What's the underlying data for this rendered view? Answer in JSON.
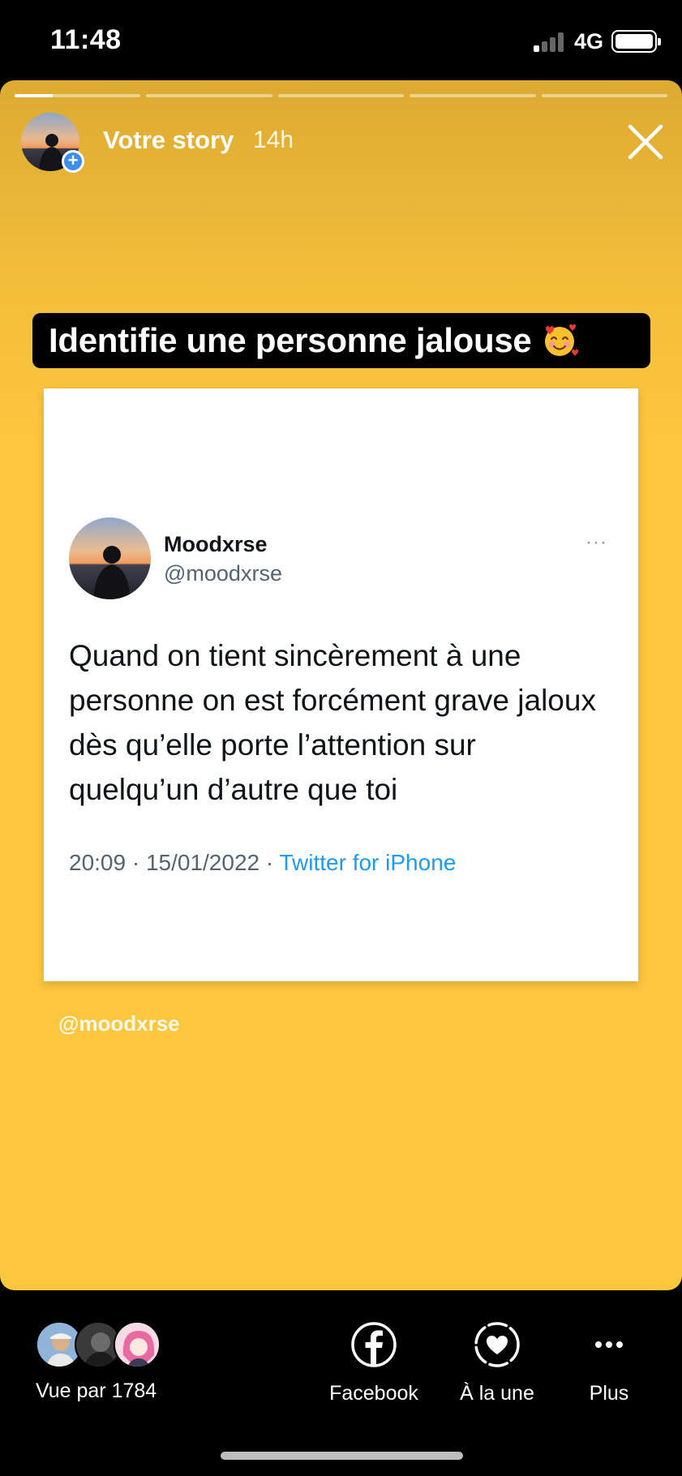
{
  "status_bar": {
    "time": "11:48",
    "network": "4G"
  },
  "story": {
    "progress": {
      "segments": 5,
      "current_segment_fraction": 0.3
    },
    "owner_label": "Votre story",
    "age": "14h",
    "background_color": "#fdc63f",
    "banner": {
      "text": "Identifie une personne jalouse",
      "emoji": "smiling-face-with-hearts-icon"
    },
    "tweet": {
      "name": "Moodxrse",
      "handle": "@moodxrse",
      "more": "···",
      "text": "Quand on tient sincèrement à une personne on est forcément grave jaloux dès qu’elle porte l’attention sur quelqu’un d’autre que toi",
      "date_time": "20:09 · 15/01/2022 · ",
      "source": "Twitter for iPhone",
      "source_color": "#1d9bf0"
    },
    "watermark": "@moodxrse"
  },
  "bottom_bar": {
    "viewers_label": "Vue par 1784",
    "actions": [
      {
        "label": "Facebook",
        "icon": "facebook-icon"
      },
      {
        "label": "À la une",
        "icon": "highlight-heart-icon"
      },
      {
        "label": "Plus",
        "icon": "more-icon"
      }
    ]
  }
}
